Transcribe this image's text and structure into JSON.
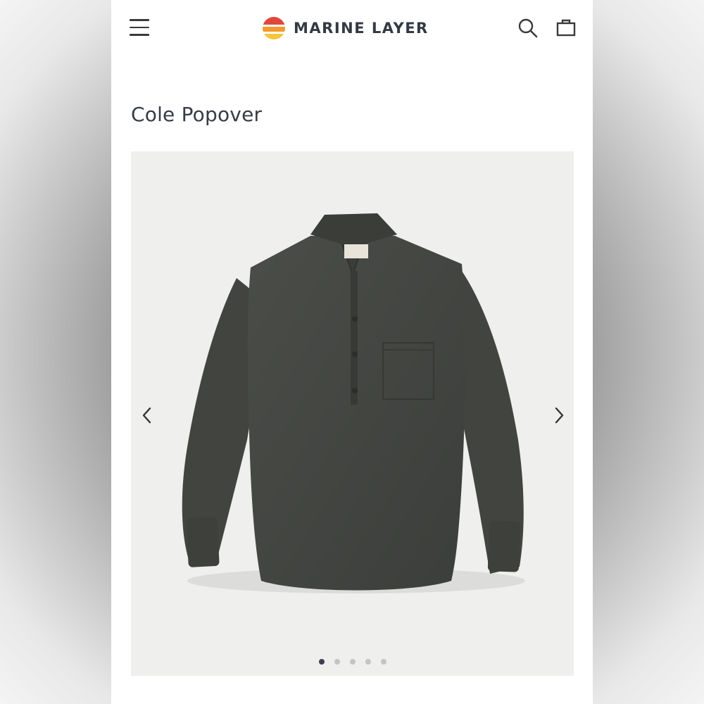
{
  "header": {
    "menu_icon": "hamburger-menu-icon",
    "brand": "MARINE LAYER",
    "logo_icon": "sunset-stripes-logo",
    "search_icon": "search-icon",
    "bag_icon": "shopping-bag-icon"
  },
  "product": {
    "title": "Cole Popover",
    "image_description_icon": "shirt-product-image"
  },
  "gallery": {
    "prev_icon": "chevron-left-icon",
    "next_icon": "chevron-right-icon",
    "dots": [
      true,
      false,
      false,
      false,
      false
    ]
  },
  "colors": {
    "brand_red": "#e0473c",
    "brand_orange": "#f29a2e",
    "brand_yellow": "#f8c43c",
    "text_dark": "#363c46",
    "active_dot": "#3a4050",
    "inactive_dot": "#c4c4c4"
  }
}
